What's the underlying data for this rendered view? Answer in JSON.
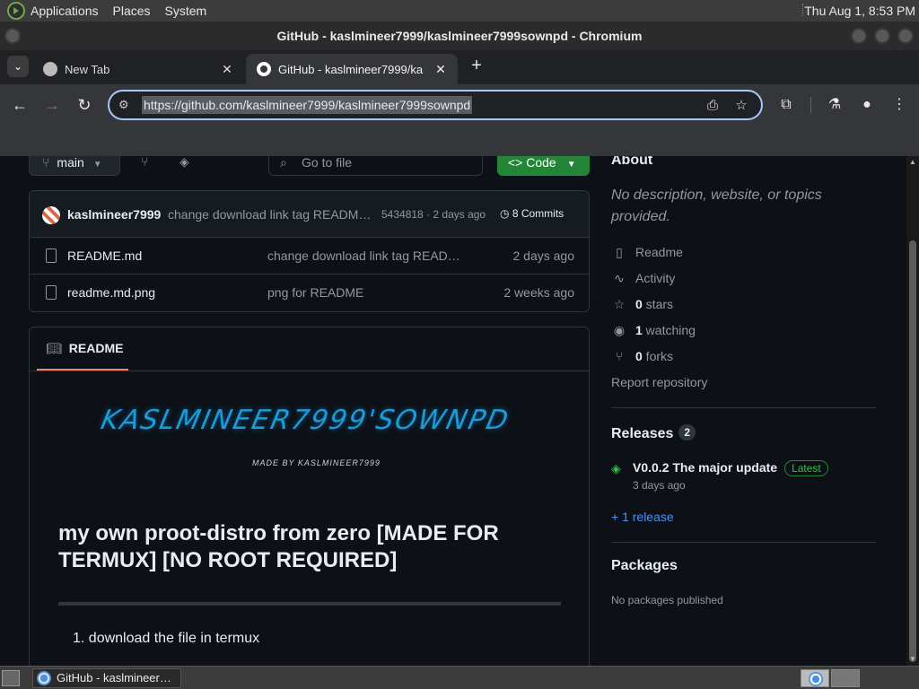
{
  "system_panel": {
    "menus": [
      "Applications",
      "Places",
      "System"
    ],
    "clock": "Thu Aug  1,  8:53 PM"
  },
  "window": {
    "title": "GitHub - kaslmineer7999/kaslmineer7999sownpd - Chromium"
  },
  "tabs": [
    {
      "label": "New Tab",
      "active": false,
      "icon": "globe-icon"
    },
    {
      "label": "GitHub - kaslmineer7999/ka",
      "active": true,
      "icon": "github-icon"
    }
  ],
  "toolbar": {
    "url": "https://github.com/kaslmineer7999/kaslmineer7999sownpd"
  },
  "repo": {
    "branch": "main",
    "go_to_file_placeholder": "Go to file",
    "code_button": "Code",
    "latest_commit": {
      "author": "kaslmineer7999",
      "message": "change download link tag READM…",
      "hash_time": "5434818 · 2 days ago",
      "commits": "8 Commits"
    },
    "files": [
      {
        "name": "README.md",
        "message": "change download link tag READ…",
        "date": "2 days ago"
      },
      {
        "name": "readme.md.png",
        "message": "png for README",
        "date": "2 weeks ago"
      }
    ]
  },
  "readme": {
    "tab_label": "README",
    "banner_title": "KASLMINEER7999'SOWNPD",
    "banner_sub": "MADE BY KASLMINEER7999",
    "heading": "my own proot-distro from zero [MADE FOR TERMUX] [NO ROOT REQUIRED]",
    "list_item": "1. download the file in termux"
  },
  "sidebar": {
    "about_heading": "About",
    "description": "No description, website, or topics provided.",
    "readme": "Readme",
    "activity": "Activity",
    "stars_count": "0",
    "stars_label": " stars",
    "watching_count": "1",
    "watching_label": " watching",
    "forks_count": "0",
    "forks_label": " forks",
    "report": "Report repository",
    "releases_heading": "Releases",
    "releases_count": "2",
    "release_title": "V0.0.2 The major update",
    "release_badge": "Latest",
    "release_date": "3 days ago",
    "more_releases": "+ 1 release",
    "packages_heading": "Packages",
    "packages_empty": "No packages published"
  },
  "taskbar": {
    "task_label": "GitHub - kaslmineer…"
  }
}
